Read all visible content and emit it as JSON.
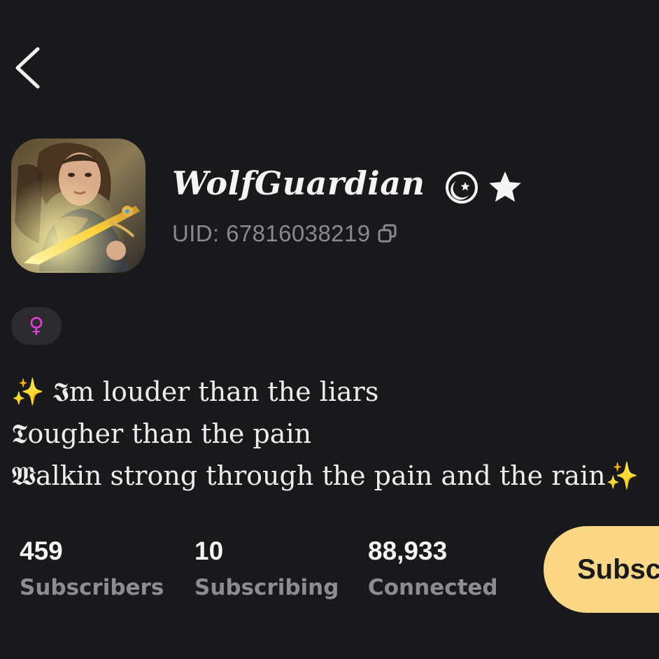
{
  "colors": {
    "background": "#19181b",
    "text_primary": "#f2f2f2",
    "text_secondary": "#8a8a8d",
    "gender_accent": "#e43fd4",
    "sparkle": "#f7c53a",
    "subscribe_button_bg": "#fbd786"
  },
  "header": {
    "back_icon": "chevron-left-icon"
  },
  "profile": {
    "display_name": "WolfGuardian",
    "name_decoration": "☪★",
    "uid": "UID: 67816038219",
    "copy_icon": "copy-icon",
    "gender_icon": "female-symbol-icon",
    "gender_symbol": "♀"
  },
  "bio": {
    "line1_sparkle": "✨",
    "line1": "𝕴m louder than the liars",
    "line2": "𝕿ougher than the pain",
    "line3": "𝖂alkin strong through the pain and the rain",
    "line3_sparkle": "✨"
  },
  "stats": {
    "subscribers": {
      "count": "459",
      "label": "Subscribers"
    },
    "subscribing": {
      "count": "10",
      "label": "Subscribing"
    },
    "connected": {
      "count": "88,933",
      "label": "Connected"
    }
  },
  "actions": {
    "subscribe_label": "Subsc"
  }
}
